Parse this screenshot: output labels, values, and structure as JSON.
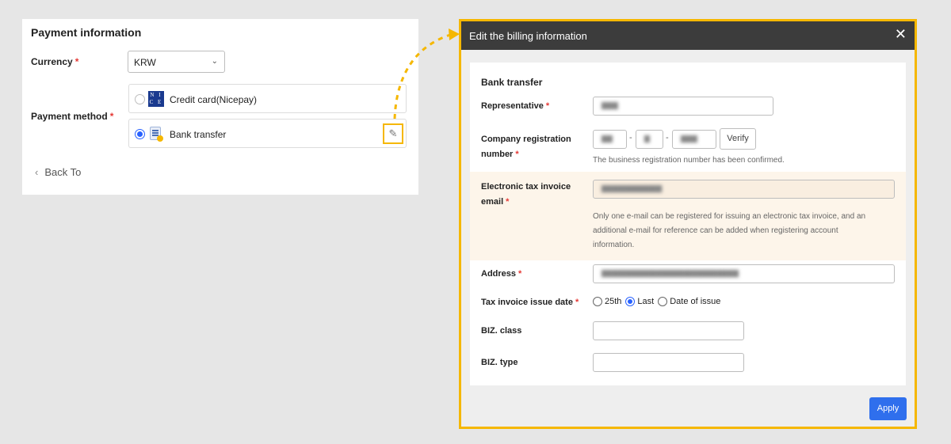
{
  "payment": {
    "title": "Payment information",
    "currency_label": "Currency",
    "currency_value": "KRW",
    "method_label": "Payment method",
    "required_mark": "*",
    "methods": [
      {
        "label": "Credit card(Nicepay)",
        "selected": false,
        "logo_text": "N I C E"
      },
      {
        "label": "Bank transfer",
        "selected": true
      }
    ],
    "back_label": "Back To"
  },
  "modal": {
    "title": "Edit the billing information",
    "close_glyph": "✕",
    "section_title": "Bank transfer",
    "representative_label": "Representative",
    "company_reg_label_1": "Company registration",
    "company_reg_label_2": "number",
    "verify_label": "Verify",
    "reg_hint": "The business registration number has been confirmed.",
    "tax_email_label_1": "Electronic tax invoice",
    "tax_email_label_2": "email",
    "tax_email_hint_1": "Only one e-mail can be registered for issuing an electronic tax invoice, and an",
    "tax_email_hint_2": "additional e-mail for reference can be added when registering account",
    "tax_email_hint_3": "information.",
    "address_label": "Address",
    "issue_date_label": "Tax invoice issue date",
    "issue_date_options": [
      {
        "label": "25th",
        "selected": false
      },
      {
        "label": "Last",
        "selected": true
      },
      {
        "label": "Date of issue",
        "selected": false
      }
    ],
    "biz_class_label": "BIZ. class",
    "biz_type_label": "BIZ. type",
    "apply_label": "Apply"
  },
  "colors": {
    "highlight": "#f5b700",
    "primary": "#2f6fed",
    "header_bg": "#3c3c3c",
    "required": "#e53935"
  }
}
